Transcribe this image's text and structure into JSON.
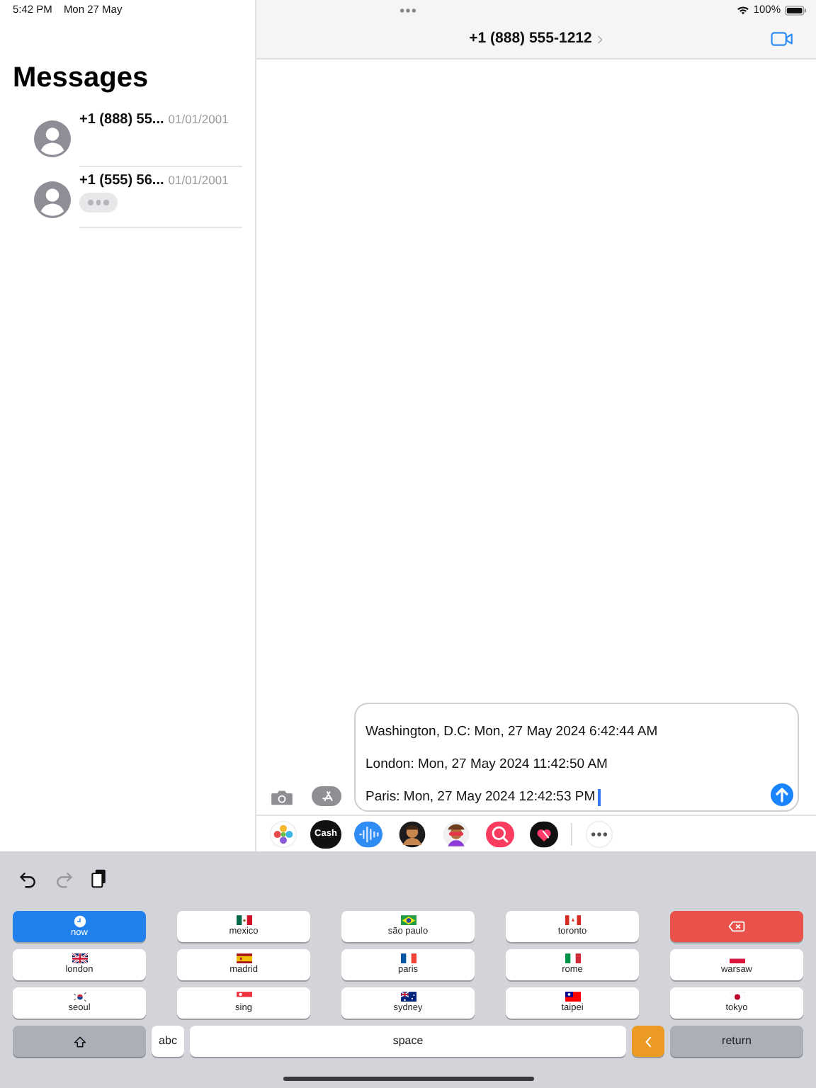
{
  "status_bar": {
    "time": "5:42 PM",
    "date": "Mon 27 May",
    "battery": "100%"
  },
  "sidebar": {
    "title": "Messages",
    "conversations": [
      {
        "name": "+1 (888) 55...",
        "date": "01/01/2001",
        "typing": false
      },
      {
        "name": "+1 (555) 56...",
        "date": "01/01/2001",
        "typing": true
      }
    ]
  },
  "conversation": {
    "title": "+1 (888) 555-1212"
  },
  "compose": {
    "lines": [
      "Washington, D.C: Mon, 27 May 2024 6:42:44 AM",
      "London: Mon, 27 May 2024 11:42:50 AM",
      "Paris: Mon, 27 May 2024 12:42:53 PM"
    ]
  },
  "apps": [
    {
      "kind": "photos"
    },
    {
      "kind": "cash",
      "label": "Cash"
    },
    {
      "kind": "audio"
    },
    {
      "kind": "avatar"
    },
    {
      "kind": "avatar2"
    },
    {
      "kind": "search"
    },
    {
      "kind": "heart"
    },
    {
      "kind": "more"
    }
  ],
  "keyboard": {
    "keys": [
      {
        "kind": "now",
        "label": "now"
      },
      {
        "kind": "city",
        "label": "mexico"
      },
      {
        "kind": "city",
        "label": "são paulo"
      },
      {
        "kind": "city",
        "label": "toronto"
      },
      {
        "kind": "delete"
      },
      {
        "kind": "city",
        "label": "london"
      },
      {
        "kind": "city",
        "label": "madrid"
      },
      {
        "kind": "city",
        "label": "paris"
      },
      {
        "kind": "city",
        "label": "rome"
      },
      {
        "kind": "city",
        "label": "warsaw"
      },
      {
        "kind": "city",
        "label": "seoul"
      },
      {
        "kind": "city",
        "label": "sing"
      },
      {
        "kind": "city",
        "label": "sydney"
      },
      {
        "kind": "city",
        "label": "taipei"
      },
      {
        "kind": "city",
        "label": "tokyo"
      }
    ],
    "bottom": [
      {
        "kind": "shift"
      },
      {
        "kind": "abc",
        "label": "abc"
      },
      {
        "kind": "space",
        "label": "space"
      },
      {
        "kind": "back"
      },
      {
        "kind": "return",
        "label": "return"
      }
    ]
  }
}
